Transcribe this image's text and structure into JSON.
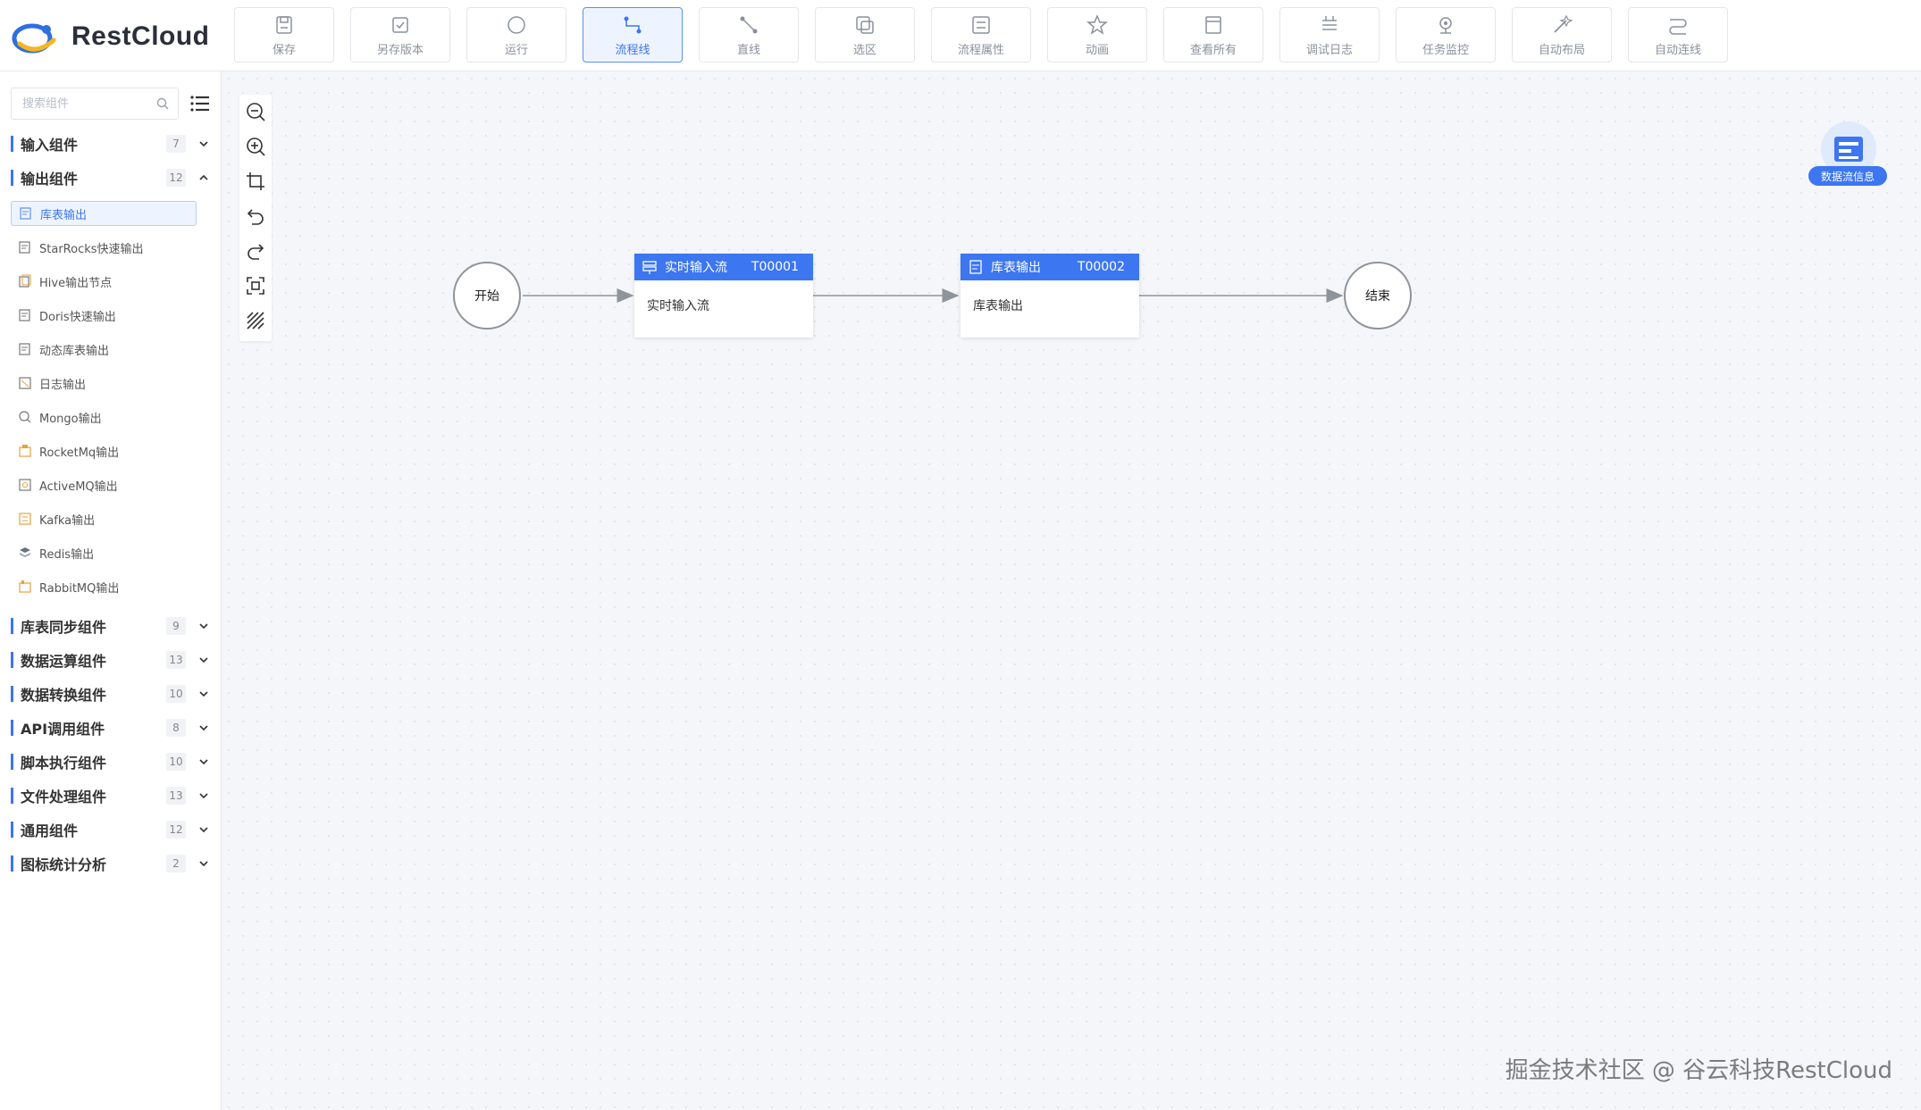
{
  "brand": {
    "name": "RestCloud",
    "logo_icon": "restcloud-logo"
  },
  "toolbar": [
    {
      "label": "保存",
      "icon": "save-icon",
      "active": false
    },
    {
      "label": "另存版本",
      "icon": "save-version-icon",
      "active": false
    },
    {
      "label": "运行",
      "icon": "run-icon",
      "active": false
    },
    {
      "label": "流程线",
      "icon": "flow-line-icon",
      "active": true
    },
    {
      "label": "直线",
      "icon": "straight-line-icon",
      "active": false
    },
    {
      "label": "选区",
      "icon": "selection-icon",
      "active": false
    },
    {
      "label": "流程属性",
      "icon": "flow-properties-icon",
      "active": false
    },
    {
      "label": "动画",
      "icon": "animation-icon",
      "active": false
    },
    {
      "label": "查看所有",
      "icon": "view-all-icon",
      "active": false
    },
    {
      "label": "调试日志",
      "icon": "debug-log-icon",
      "active": false
    },
    {
      "label": "任务监控",
      "icon": "task-monitor-icon",
      "active": false
    },
    {
      "label": "自动布局",
      "icon": "auto-layout-icon",
      "active": false
    },
    {
      "label": "自动连线",
      "icon": "auto-connect-icon",
      "active": false
    }
  ],
  "sidebar": {
    "search_placeholder": "搜索组件",
    "groups_top": [
      {
        "label": "输入组件",
        "count": "7",
        "expanded": false
      },
      {
        "label": "输出组件",
        "count": "12",
        "expanded": true
      }
    ],
    "output_items": [
      {
        "label": "库表输出",
        "icon": "table-output-icon",
        "selected": true
      },
      {
        "label": "StarRocks快速输出",
        "icon": "starrocks-output-icon",
        "selected": false
      },
      {
        "label": "Hive输出节点",
        "icon": "hive-output-icon",
        "selected": false
      },
      {
        "label": "Doris快速输出",
        "icon": "doris-output-icon",
        "selected": false
      },
      {
        "label": "动态库表输出",
        "icon": "dynamic-table-output-icon",
        "selected": false
      },
      {
        "label": "日志输出",
        "icon": "log-output-icon",
        "selected": false
      },
      {
        "label": "Mongo输出",
        "icon": "mongo-output-icon",
        "selected": false
      },
      {
        "label": "RocketMq输出",
        "icon": "rocketmq-output-icon",
        "selected": false
      },
      {
        "label": "ActiveMQ输出",
        "icon": "activemq-output-icon",
        "selected": false
      },
      {
        "label": "Kafka输出",
        "icon": "kafka-output-icon",
        "selected": false
      },
      {
        "label": "Redis输出",
        "icon": "redis-output-icon",
        "selected": false
      },
      {
        "label": "RabbitMQ输出",
        "icon": "rabbitmq-output-icon",
        "selected": false
      }
    ],
    "groups_bottom": [
      {
        "label": "库表同步组件",
        "count": "9"
      },
      {
        "label": "数据运算组件",
        "count": "13"
      },
      {
        "label": "数据转换组件",
        "count": "10"
      },
      {
        "label": "API调用组件",
        "count": "8"
      },
      {
        "label": "脚本执行组件",
        "count": "10"
      },
      {
        "label": "文件处理组件",
        "count": "13"
      },
      {
        "label": "通用组件",
        "count": "12"
      },
      {
        "label": "图标统计分析",
        "count": "2"
      }
    ]
  },
  "canvas": {
    "zoom_tools": [
      "zoom-out-icon",
      "zoom-in-icon",
      "fit-view-icon",
      "undo-icon",
      "redo-icon",
      "fullscreen-icon",
      "grid-toggle-icon"
    ],
    "start_node": {
      "label": "开始"
    },
    "end_node": {
      "label": "结束"
    },
    "nodes": [
      {
        "title": "实时输入流",
        "code": "T00001",
        "body": "实时输入流"
      },
      {
        "title": "库表输出",
        "code": "T00002",
        "body": "库表输出"
      }
    ],
    "info_badge": {
      "label": "数据流信息"
    }
  },
  "watermark": "掘金技术社区 @ 谷云科技RestCloud",
  "colors": {
    "accent": "#3c76f0",
    "canvas_bg": "#f5f6f9"
  }
}
